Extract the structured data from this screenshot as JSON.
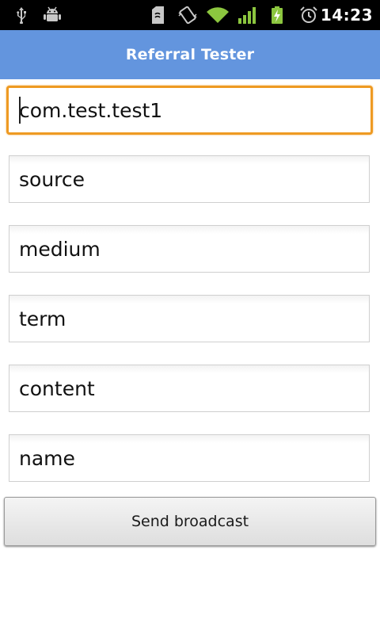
{
  "status_bar": {
    "time": "14:23",
    "icons": [
      "usb-icon",
      "android-debug-icon",
      "sim-card-icon",
      "vibrate-icon",
      "wifi-icon",
      "signal-icon",
      "battery-charging-icon",
      "alarm-icon"
    ],
    "accent_color": "#8cc63f"
  },
  "app": {
    "title": "Referral Tester",
    "title_bar_color": "#6395de"
  },
  "form": {
    "package": {
      "value": "com.test.test1",
      "placeholder": ""
    },
    "source": {
      "value": "",
      "placeholder": "source"
    },
    "medium": {
      "value": "",
      "placeholder": "medium"
    },
    "term": {
      "value": "",
      "placeholder": "term"
    },
    "content": {
      "value": "",
      "placeholder": "content"
    },
    "name": {
      "value": "",
      "placeholder": "name"
    },
    "focus_color": "#ee9a22"
  },
  "actions": {
    "send_label": "Send broadcast"
  }
}
